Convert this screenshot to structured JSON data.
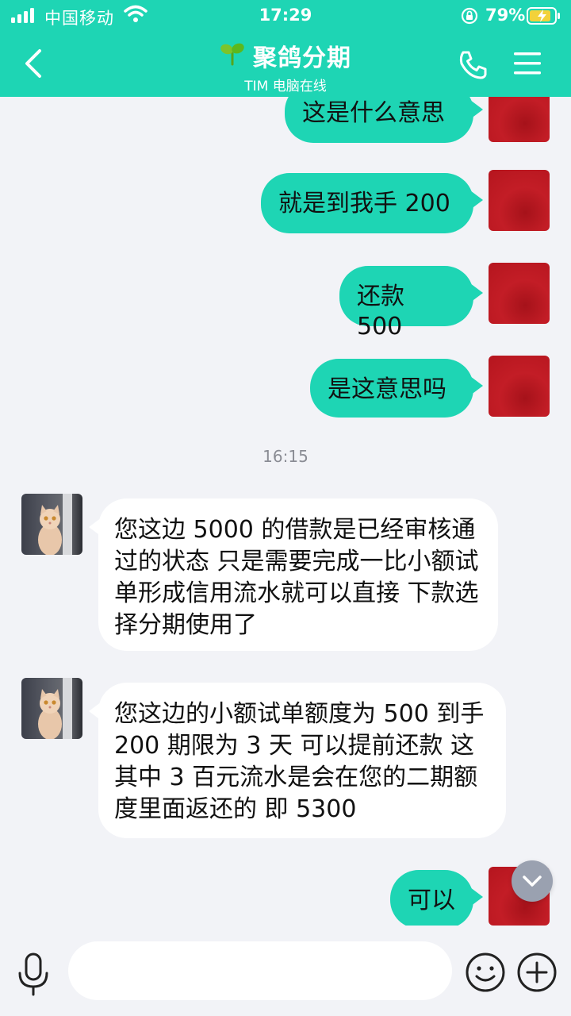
{
  "status_bar": {
    "carrier": "中国移动",
    "time": "17:29",
    "battery": "79%"
  },
  "header": {
    "title": "聚鸽分期",
    "subtitle": "TIM 电脑在线"
  },
  "messages_out_top": [
    {
      "text": "这是什么意思"
    },
    {
      "text": "就是到我手 200"
    },
    {
      "text": "还款 500"
    },
    {
      "text": "是这意思吗"
    }
  ],
  "timestamp": "16:15",
  "messages_in": [
    {
      "text": "您这边 5000 的借款是已经审核通过的状态    只是需要完成一比小额试单形成信用流水就可以直接 下款选择分期使用了"
    },
    {
      "text": "您这边的小额试单额度为 500 到手 200 期限为 3 天 可以提前还款 这其中 3 百元流水是会在您的二期额度里面返还的 即 5300"
    }
  ],
  "message_out_last": {
    "text": "可以"
  },
  "input": {
    "value": ""
  }
}
